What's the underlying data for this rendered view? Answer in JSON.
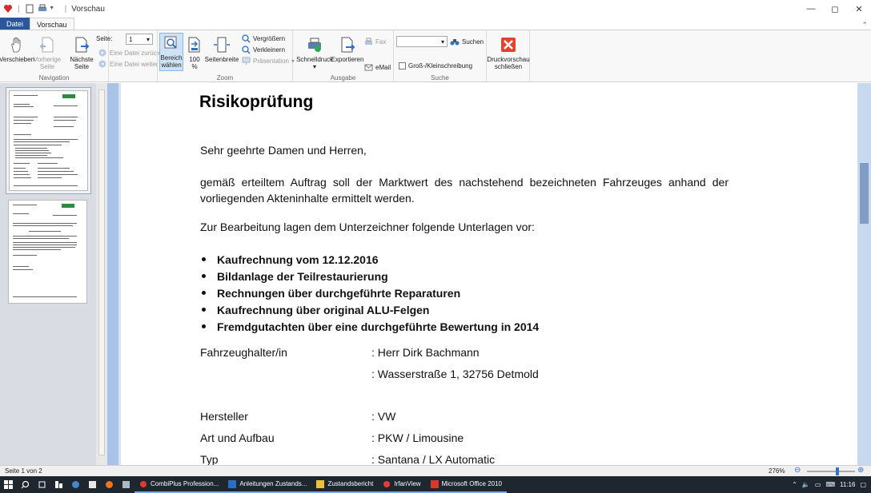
{
  "window": {
    "title": "Vorschau",
    "controls": {
      "minimize": "—",
      "maximize": "◻",
      "close": "✕"
    }
  },
  "ribbon_tabs": [
    {
      "label": "Datei"
    },
    {
      "label": "Vorschau"
    }
  ],
  "ribbon": {
    "navigation": {
      "group_label": "Navigation",
      "verschieben": "Verschieben",
      "vorherige": [
        "Vorherige",
        "Seite"
      ],
      "naechste": [
        "Nächste",
        "Seite"
      ],
      "seite_label": "Seite:",
      "seite_value": "1",
      "eine_datei_zurueck": "Eine Datei zurück",
      "eine_datei_weiter": "Eine Datei weiter"
    },
    "zoom": {
      "group_label": "Zoom",
      "bereich": [
        "Bereich",
        "wählen"
      ],
      "hundert": [
        "100",
        "%"
      ],
      "seitenbreite": "Seitenbreite",
      "vergroessern": "Vergrößern",
      "verkleinern": "Verkleinern",
      "praesentation": "Präsentation"
    },
    "ausgabe": {
      "group_label": "Ausgabe",
      "schnelldruck": "Schnelldruck",
      "exportieren": "Exportieren",
      "fax": "Fax",
      "email": "eMail"
    },
    "suche": {
      "group_label": "Suche",
      "search_value": "",
      "suchen": "Suchen",
      "gross_klein": "Groß-/Kleinschreibung"
    },
    "druckvorschau": {
      "label": [
        "Druckvorschau",
        "schließen"
      ]
    }
  },
  "document": {
    "heading": "Risikoprüfung",
    "salutation": "Sehr geehrte Damen und Herren,",
    "paragraph1": "gemäß erteiltem Auftrag soll der Marktwert des nachstehend bezeichneten Fahrzeuges anhand der vorliegenden Akteninhalte ermittelt werden.",
    "paragraph2": "Zur Bearbeitung lagen dem Unterzeichner folgende Unterlagen vor:",
    "bullets": [
      "Kaufrechnung vom 12.12.2016",
      "Bildanlage der Teilrestaurierung",
      "Rechnungen über durchgeführte Reparaturen",
      "Kaufrechnung über original ALU-Felgen",
      "Fremdgutachten über eine durchgeführte Bewertung in 2014"
    ],
    "fields": [
      {
        "key": "Fahrzeughalter/in",
        "value": ": Herr Dirk Bachmann"
      },
      {
        "key": "",
        "value": ": Wasserstraße 1, 32756 Detmold"
      },
      {
        "key": "Hersteller",
        "value": ": VW"
      },
      {
        "key": "Art und Aufbau",
        "value": ": PKW / Limousine"
      },
      {
        "key": "Typ",
        "value": ": Santana / LX Automatic"
      }
    ]
  },
  "statusbar": {
    "page_info": "Seite 1 von 2",
    "zoom": "276%",
    "zoom_level_fraction": 0.6
  },
  "taskbar": {
    "apps": [
      {
        "label": "CombiPlus Profession...",
        "color": "#e8372c"
      },
      {
        "label": "Anleitungen Zustands...",
        "color": "#2b6cc4"
      },
      {
        "label": "Zustandsbericht",
        "color": "#f2c130"
      },
      {
        "label": "IrfanView",
        "color": "#e83a3a"
      },
      {
        "label": "Microsoft Office 2010",
        "color": "#d9382c"
      }
    ],
    "time": "11:16"
  }
}
